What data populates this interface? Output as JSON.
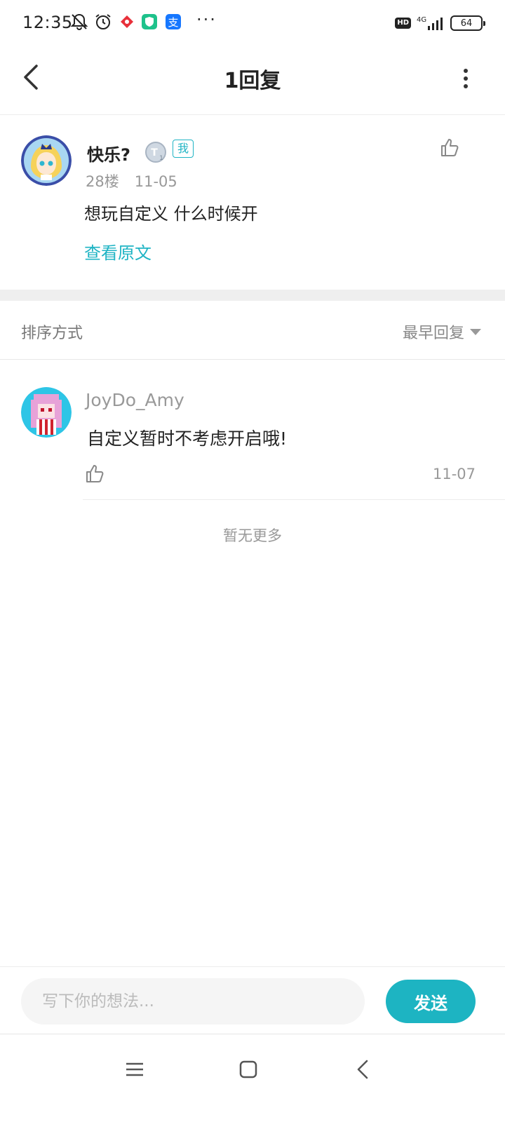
{
  "status_bar": {
    "time": "12:35",
    "network": "4G",
    "battery": "64",
    "hd_label": "HD",
    "icons": [
      "mute-bell-icon",
      "alarm-icon",
      "app-red-icon",
      "app-green-shield-icon",
      "alipay-icon",
      "more-dots-icon",
      "signal-icon",
      "battery-icon"
    ]
  },
  "header": {
    "title": "1回复",
    "back_icon": "chevron-left-icon",
    "more_icon": "vertical-dots-icon"
  },
  "post": {
    "username": "快乐?",
    "level_badge": "T1",
    "me_badge": "我",
    "floor": "28楼",
    "date": "11-05",
    "text": "想玩自定义 什么时候开",
    "view_original": "查看原文",
    "like_icon": "thumbs-up-icon"
  },
  "sort": {
    "label": "排序方式",
    "value": "最早回复"
  },
  "replies": [
    {
      "username": "JoyDo_Amy",
      "text": "自定义暂时不考虑开启哦!",
      "date": "11-07"
    }
  ],
  "no_more": "暂无更多",
  "input": {
    "placeholder": "写下你的想法...",
    "send_label": "发送"
  },
  "colors": {
    "accent": "#1FB4C4",
    "send_button": "#1DB4C2"
  },
  "nav_icons": [
    "menu-icon",
    "home-square-icon",
    "back-triangle-icon"
  ]
}
